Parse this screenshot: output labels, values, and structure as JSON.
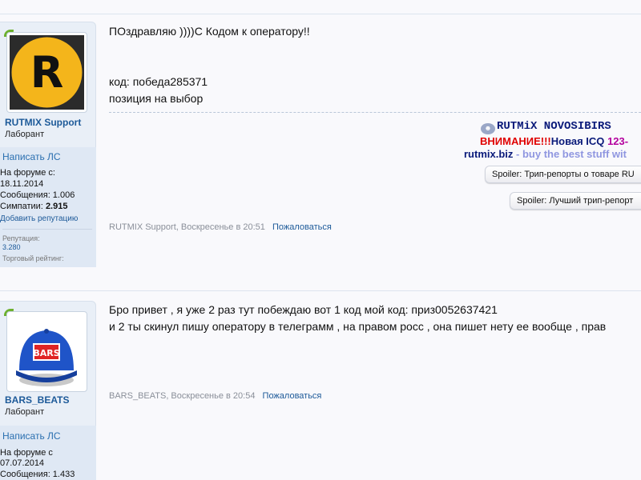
{
  "posts": [
    {
      "user": {
        "username": "RUTMIX Support",
        "title": "Лаборант",
        "pm_link": "Написать ЛС",
        "joined_label": "На форуме с:",
        "joined_value": "18.11.2014",
        "messages": "Сообщения: 1.006",
        "likes_label": "Симпатии:",
        "likes_value": "2.915",
        "add_rep": "Добавить репутацию",
        "rep_label": "Репутация:",
        "rep_value": "3.280",
        "trade_label": "Торговый рейтинг:",
        "avatar_letter": "R"
      },
      "message_lines": [
        "ПОздравляю ))))С Кодом к оператору!!",
        "код: победа285371",
        "позиция на выбор"
      ],
      "signature": {
        "brand": "RUTMiX NOVOSIBIRS",
        "warning": "ВНИМАНИЕ!!!",
        "icq_text": "Новая ICQ",
        "icq_number": "123-",
        "site": "rutmix.biz",
        "tagline": "- buy the best stuff wit",
        "spoiler1": "Spoiler: Трип-репорты о товаре RU",
        "spoiler2": "Spoiler: Лучший трип-репорт"
      },
      "meta": "RUTMIX Support, Воскресенье в 20:51",
      "report": "Пожаловаться"
    },
    {
      "user": {
        "username": "BARS_BEATS",
        "title": "Лаборант",
        "pm_link": "Написать ЛС",
        "joined_label": "На форуме с",
        "joined_value": "07.07.2014",
        "messages": "Сообщения: 1.433",
        "cap_label": "BARS"
      },
      "message_lines": [
        "Бро привет , я уже 2 раз тут побеждаю вот 1 код мой код: приз0052637421",
        "и 2 ты скинул пишу оператору в телеграмм , на правом росс , она пишет нету ее вообще , прав"
      ],
      "meta": "BARS_BEATS, Воскресенье в 20:54",
      "report": "Пожаловаться"
    }
  ],
  "colors": {
    "link": "#1d5a99",
    "warning": "#e00000",
    "avatar_yellow": "#f4b51b",
    "cap_blue": "#1f54c8"
  }
}
